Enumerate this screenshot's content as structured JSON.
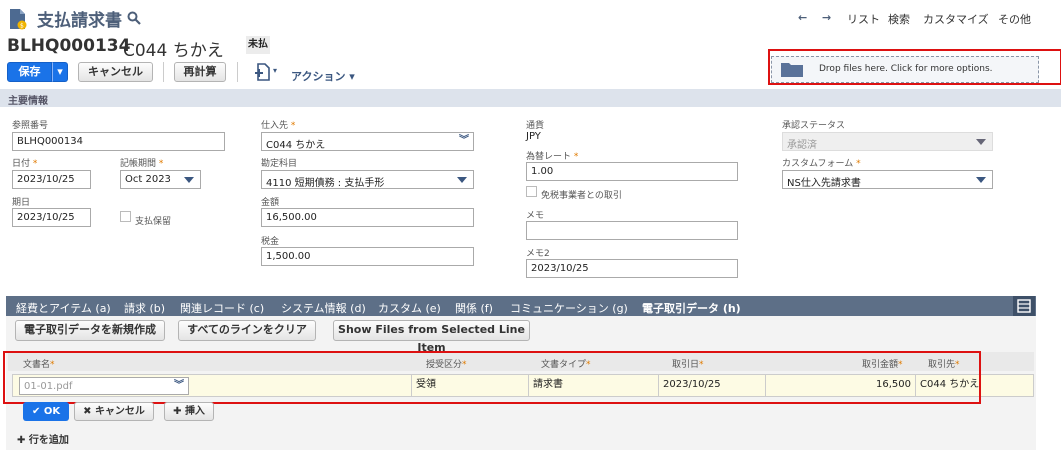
{
  "header": {
    "title": "支払請求書",
    "record_id": "BLHQ000134",
    "record_name": "C044 ちかえ",
    "status_badge": "未払",
    "nav": {
      "list": "リスト",
      "search": "検索",
      "customize": "カスタマイズ",
      "more": "その他"
    }
  },
  "toolbar": {
    "save": "保存",
    "cancel": "キャンセル",
    "recalc": "再計算",
    "actions": "アクション",
    "drop_files": "Drop files here. Click for more options."
  },
  "section_title": "主要情報",
  "fields": {
    "ref_no": {
      "label": "参照番号",
      "value": "BLHQ000134"
    },
    "date": {
      "label": "日付",
      "value": "2023/10/25"
    },
    "period": {
      "label": "記帳期間",
      "value": "Oct 2023"
    },
    "due": {
      "label": "期日",
      "value": "2023/10/25"
    },
    "hold": {
      "label": "支払保留"
    },
    "vendor": {
      "label": "仕入先",
      "value": "C044 ちかえ"
    },
    "account": {
      "label": "勘定科目",
      "value": "4110 短期債務 : 支払手形"
    },
    "amount": {
      "label": "金額",
      "value": "16,500.00"
    },
    "tax": {
      "label": "税金",
      "value": "1,500.00"
    },
    "currency": {
      "label": "通貨",
      "value": "JPY"
    },
    "rate": {
      "label": "為替レート",
      "value": "1.00"
    },
    "exempt": {
      "label": "免税事業者との取引"
    },
    "memo": {
      "label": "メモ",
      "value": ""
    },
    "memo2": {
      "label": "メモ2",
      "value": "2023/10/25"
    },
    "approval": {
      "label": "承認ステータス",
      "value": "承認済"
    },
    "form": {
      "label": "カスタムフォーム",
      "value": "NS仕入先請求書"
    }
  },
  "tabs": [
    "経費とアイテム (a)",
    "請求 (b)",
    "関連レコード (c)",
    "システム情報 (d)",
    "カスタム (e)",
    "関係 (f)",
    "コミュニケーション (g)",
    "電子取引データ (h)"
  ],
  "subtab_buttons": {
    "new": "電子取引データを新規作成",
    "clear": "すべてのラインをクリア",
    "show_files": "Show Files from Selected Line Item"
  },
  "grid": {
    "columns": [
      "文書名",
      "授受区分",
      "文書タイプ",
      "取引日",
      "取引金額",
      "取引先"
    ],
    "row": {
      "doc": "01-01.pdf",
      "direction": "受領",
      "doctype": "請求書",
      "date": "2023/10/25",
      "amount": "16,500",
      "partner": "C044 ちかえ"
    },
    "ok": "OK",
    "cancel": "キャンセル",
    "insert": "挿入",
    "add_row": "行を追加"
  }
}
